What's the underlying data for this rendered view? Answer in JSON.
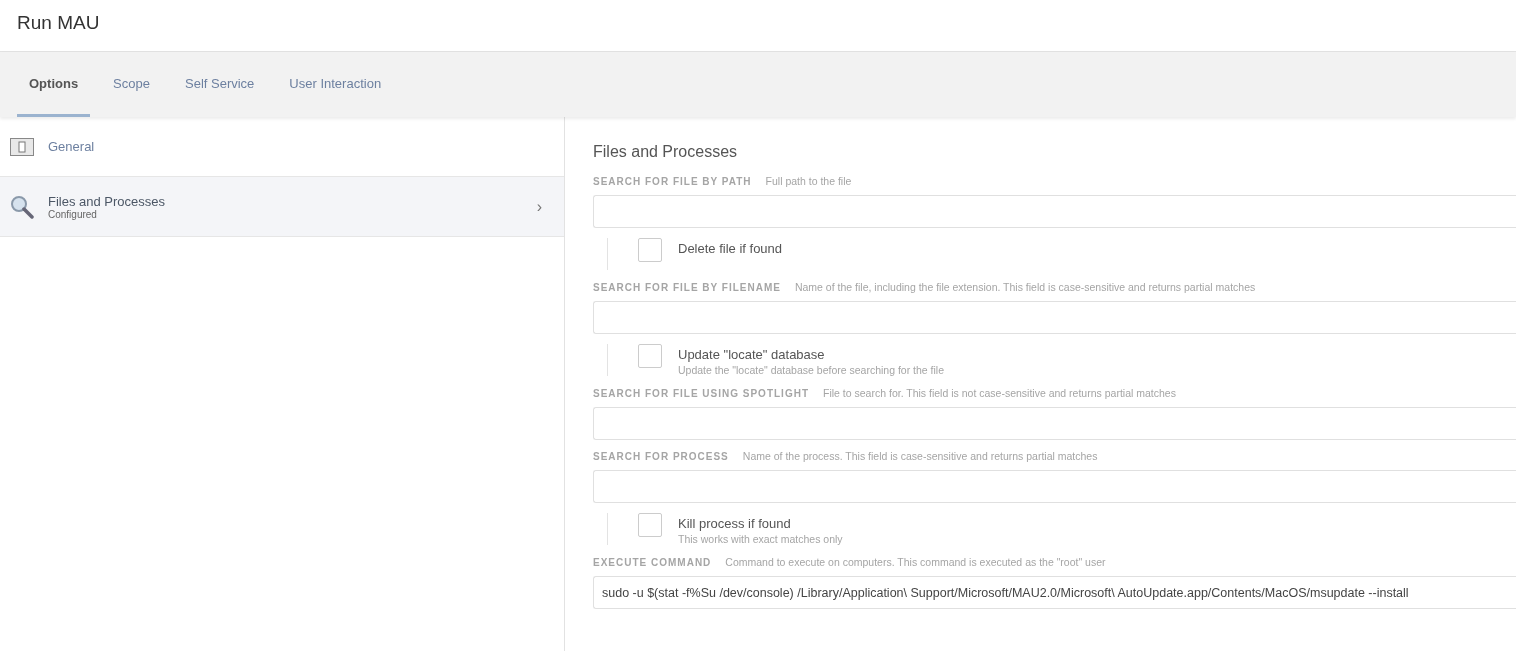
{
  "page_title": "Run MAU",
  "tabs": [
    {
      "label": "Options",
      "selected": true
    },
    {
      "label": "Scope",
      "selected": false
    },
    {
      "label": "Self Service",
      "selected": false
    },
    {
      "label": "User Interaction",
      "selected": false
    }
  ],
  "sidebar": {
    "items": [
      {
        "label": "General",
        "kind": "switch",
        "selected": false
      },
      {
        "label": "Files and Processes",
        "status": "Configured",
        "kind": "search",
        "selected": true,
        "chevron": "›"
      }
    ]
  },
  "section": {
    "title": "Files and Processes",
    "items": [
      {
        "kind": "field",
        "label": "SEARCH FOR FILE BY PATH",
        "hint": "Full path to the file"
      },
      {
        "kind": "checkbox",
        "label": "Delete file if found",
        "checked": false
      },
      {
        "kind": "field",
        "label": "SEARCH FOR FILE BY FILENAME",
        "hint": "Name of the file, including the file extension. This field is case-sensitive and returns partial matches"
      },
      {
        "kind": "checkbox",
        "label": "Update \"locate\" database",
        "description": "Update the \"locate\" database before searching for the file",
        "checked": false
      },
      {
        "kind": "field",
        "label": "SEARCH FOR FILE USING SPOTLIGHT",
        "hint": "File to search for. This field is not case-sensitive and returns partial matches"
      },
      {
        "kind": "field",
        "label": "SEARCH FOR PROCESS",
        "hint": "Name of the process. This field is case-sensitive and returns partial matches"
      },
      {
        "kind": "checkbox",
        "label": "Kill process if found",
        "description": "This works with exact matches only",
        "checked": false
      },
      {
        "kind": "field",
        "label": "EXECUTE COMMAND",
        "hint": "Command to execute on computers. This command is executed as the \"root\" user",
        "value": "sudo -u $(stat -f%Su /dev/console) /Library/Application\\ Support/Microsoft/MAU2.0/Microsoft\\ AutoUpdate.app/Contents/MacOS/msupdate --install"
      }
    ]
  }
}
